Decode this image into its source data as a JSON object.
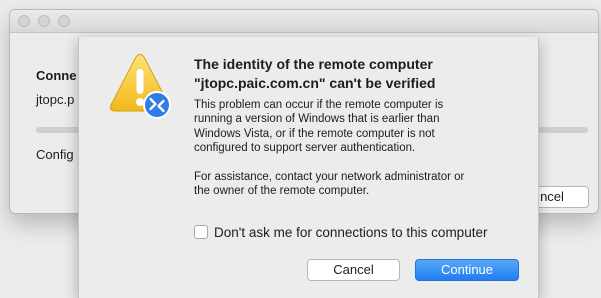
{
  "background_window": {
    "title_partial": "Conne",
    "host_partial": "jtopc.p",
    "status_partial": "Config",
    "cancel_partial": "ncel"
  },
  "dialog": {
    "title_lines": [
      "The identity of the remote computer",
      "\"jtopc.paic.com.cn\" can't be verified"
    ],
    "body_lines": [
      "This problem can occur if the remote computer is",
      "running a version of Windows that is earlier than",
      "Windows Vista, or if the remote computer is not",
      "configured to support server authentication."
    ],
    "assist_lines": [
      "For assistance, contact your network administrator or",
      "the owner of the remote computer."
    ],
    "checkbox": {
      "label": "Don't ask me for connections to this computer",
      "checked": false
    },
    "buttons": {
      "cancel": "Cancel",
      "continue": "Continue"
    },
    "icon": "warning-icon",
    "badge_icon": "remote-desktop-icon"
  },
  "colors": {
    "primary_button": "#1f7ef0",
    "warning": "#f7c630",
    "badge": "#2f7ee8"
  }
}
